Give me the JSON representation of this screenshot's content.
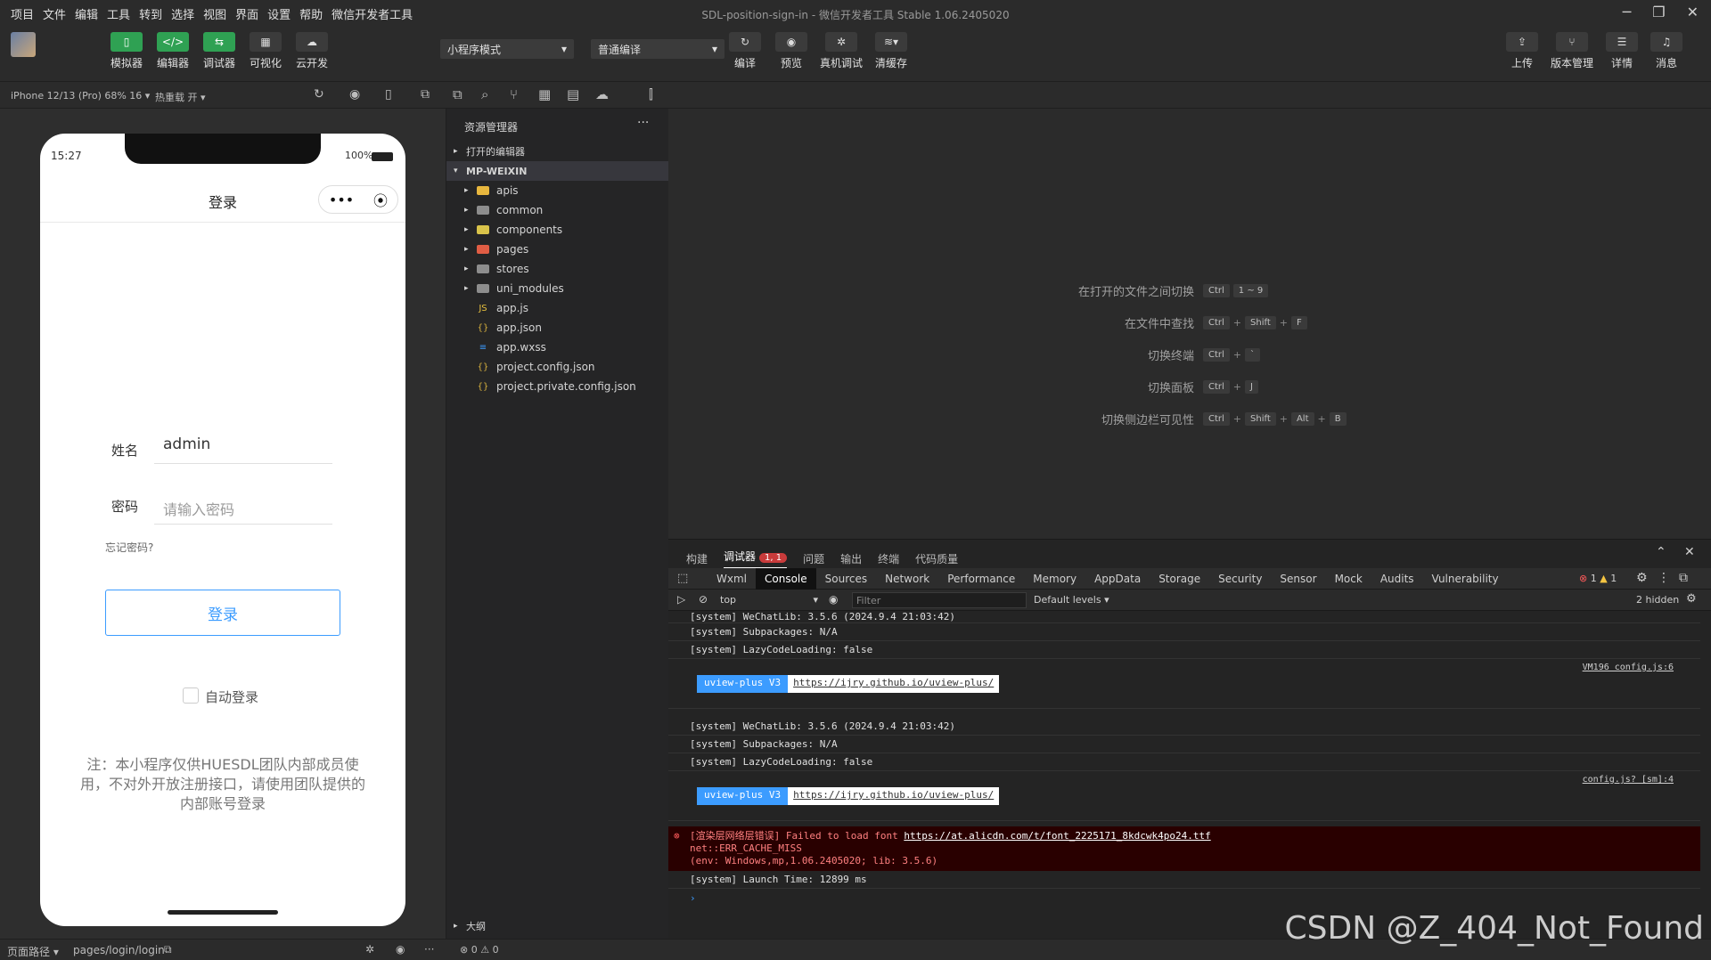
{
  "menu": [
    "项目",
    "文件",
    "编辑",
    "工具",
    "转到",
    "选择",
    "视图",
    "界面",
    "设置",
    "帮助",
    "微信开发者工具"
  ],
  "window_title": "SDL-position-sign-in - 微信开发者工具 Stable 1.06.2405020",
  "toolbar": {
    "left_buttons": [
      "模拟器",
      "编辑器",
      "调试器",
      "可视化",
      "云开发"
    ],
    "mode_select": "小程序模式",
    "compile_select": "普通编译",
    "mid_buttons": [
      "编译",
      "预览",
      "真机调试",
      "清缓存"
    ],
    "right_buttons": [
      "上传",
      "版本管理",
      "详情",
      "消息"
    ]
  },
  "subbar": {
    "device": "iPhone 12/13 (Pro) 68% 16 ▾",
    "hot_reload": "热重载 开 ▾"
  },
  "phone": {
    "time": "15:27",
    "battery": "100%",
    "nav_title": "登录",
    "name_label": "姓名",
    "name_value": "admin",
    "password_label": "密码",
    "password_placeholder": "请输入密码",
    "forgot": "忘记密码?",
    "login_button": "登录",
    "auto_login": "自动登录",
    "notice": "注：本小程序仅供HUESDL团队内部成员使用，不对外开放注册接口，请使用团队提供的内部账号登录"
  },
  "explorer": {
    "header": "资源管理器",
    "open_editors": "打开的编辑器",
    "root": "MP-WEIXIN",
    "folders": [
      "apis",
      "common",
      "components",
      "pages",
      "stores",
      "uni_modules"
    ],
    "files": [
      "app.js",
      "app.json",
      "app.wxss",
      "project.config.json",
      "project.private.config.json"
    ],
    "outline": "大纲"
  },
  "shortcuts": [
    {
      "label": "在打开的文件之间切换",
      "keys": [
        "Ctrl",
        "1 ~ 9"
      ]
    },
    {
      "label": "在文件中查找",
      "keys": [
        "Ctrl",
        "Shift",
        "F"
      ]
    },
    {
      "label": "切换终端",
      "keys": [
        "Ctrl",
        "`"
      ]
    },
    {
      "label": "切换面板",
      "keys": [
        "Ctrl",
        "J"
      ]
    },
    {
      "label": "切换侧边栏可见性",
      "keys": [
        "Ctrl",
        "Shift",
        "Alt",
        "B"
      ]
    }
  ],
  "debug": {
    "top_tabs": [
      "构建",
      "调试器",
      "问题",
      "输出",
      "终端",
      "代码质量"
    ],
    "debugger_badge": "1, 1",
    "devtools_tabs": [
      "Wxml",
      "Console",
      "Sources",
      "Network",
      "Performance",
      "Memory",
      "AppData",
      "Storage",
      "Security",
      "Sensor",
      "Mock",
      "Audits",
      "Vulnerability"
    ],
    "error_count": "1",
    "warn_count": "1",
    "context": "top",
    "filter_placeholder": "Filter",
    "levels": "Default levels ▾",
    "hidden": "2 hidden",
    "lines": {
      "l0": "[system] WeChatLib: 3.5.6 (2024.9.4 21:03:42)",
      "l1": "[system] Subpackages: N/A",
      "l2": "[system] LazyCodeLoading: false",
      "src1": "VM196 config.js:6",
      "banner_tag": "uview-plus V3",
      "banner_link": "https://ijry.github.io/uview-plus/",
      "l3": "[system] WeChatLib: 3.5.6 (2024.9.4 21:03:42)",
      "l4": "[system] Subpackages: N/A",
      "l5": "[system] LazyCodeLoading: false",
      "src2": "config.js? [sm]:4",
      "err1": "[渲染层网络层错误] Failed to load font",
      "err_link": "https://at.alicdn.com/t/font_2225171_8kdcwk4po24.ttf",
      "err2": "net::ERR_CACHE_MISS",
      "err3": "(env: Windows,mp,1.06.2405020; lib: 3.5.6)",
      "l6": "[system] Launch Time: 12899 ms"
    }
  },
  "status": {
    "path_label": "页面路径 ▾",
    "path": "pages/login/login",
    "problems": "⊗ 0 ⚠ 0"
  },
  "watermark": "CSDN @Z_404_Not_Found"
}
